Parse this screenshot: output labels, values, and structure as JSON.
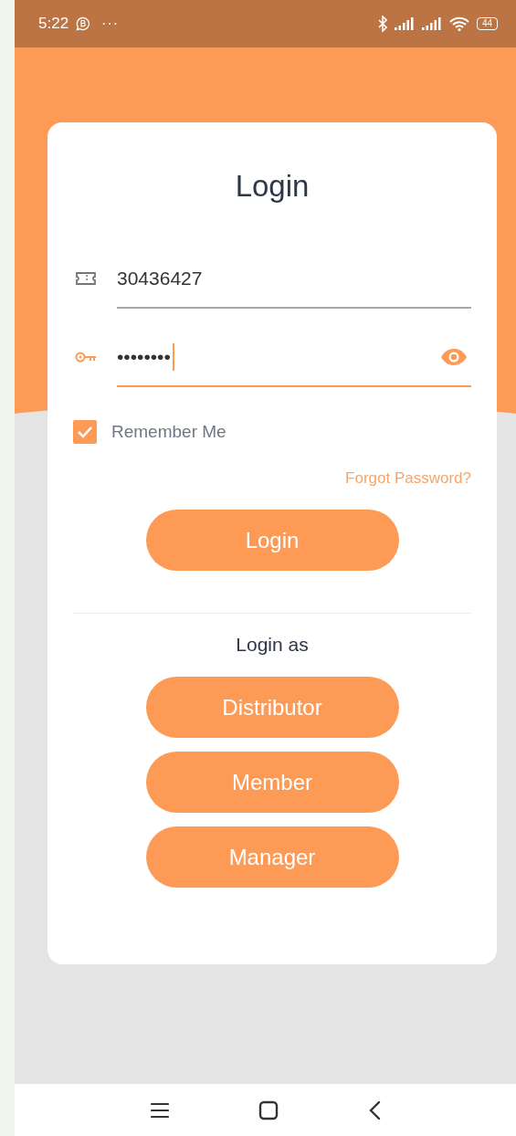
{
  "status_bar": {
    "time": "5:22",
    "overflow": "···",
    "battery": "44"
  },
  "title": "Login",
  "fields": [
    {
      "kind": "id",
      "value": "30436427",
      "focused": false
    },
    {
      "kind": "password",
      "value": "••••••••",
      "focused": true
    }
  ],
  "remember_me": {
    "label": "Remember Me",
    "checked": true
  },
  "forgot_password": "Forgot Password?",
  "login_button": "Login",
  "login_as": {
    "heading": "Login as",
    "roles": [
      "Distributor",
      "Member",
      "Manager"
    ]
  }
}
